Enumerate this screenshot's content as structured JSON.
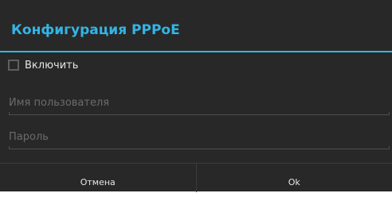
{
  "dialog": {
    "title": "Конфигурация PPPoE",
    "accent_color": "#33b5e5",
    "enable_checkbox": {
      "label": "Включить",
      "checked": false
    },
    "username_field": {
      "placeholder": "Имя пользователя",
      "value": ""
    },
    "password_field": {
      "placeholder": "Пароль",
      "value": ""
    },
    "buttons": {
      "cancel_label": "Отмена",
      "ok_label": "Ok"
    }
  }
}
